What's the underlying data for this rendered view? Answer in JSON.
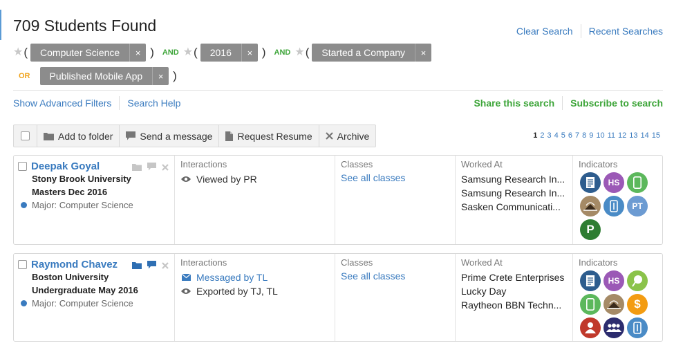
{
  "header": {
    "title": "709 Students Found",
    "clear_search": "Clear Search",
    "recent_searches": "Recent Searches"
  },
  "query": {
    "terms": [
      "Computer Science",
      "2016",
      "Started a Company",
      "Published Mobile App"
    ],
    "op_and": "AND",
    "op_or": "OR",
    "open_paren": "(",
    "close_paren": ")",
    "remove_glyph": "×",
    "star_glyph": "★"
  },
  "filters": {
    "advanced": "Show Advanced Filters",
    "help": "Search Help",
    "share": "Share this search",
    "subscribe": "Subscribe to search"
  },
  "actions": {
    "add_folder": "Add to folder",
    "send_message": "Send a message",
    "request_resume": "Request Resume",
    "archive": "Archive"
  },
  "pagination": {
    "current": "1",
    "pages": [
      "2",
      "3",
      "4",
      "5",
      "6",
      "7",
      "8",
      "9",
      "10",
      "11",
      "12",
      "13",
      "14",
      "15"
    ]
  },
  "columns": {
    "interactions": "Interactions",
    "classes": "Classes",
    "worked_at": "Worked At",
    "indicators": "Indicators"
  },
  "students": [
    {
      "name": "Deepak Goyal",
      "school": "Stony Brook University",
      "degree": "Masters Dec 2016",
      "major": "Major: Computer Science",
      "interactions": [
        "Viewed by PR"
      ],
      "classes_link": "See all classes",
      "worked_at": [
        "Samsung Research In...",
        "Samsung Research In...",
        "Sasken Communicati..."
      ],
      "indicators": [
        {
          "icon": "resume-icon",
          "text": "",
          "color": "#2e5d8e"
        },
        {
          "icon": "high-school-icon",
          "text": "HS",
          "color": "#9b59b6"
        },
        {
          "icon": "mobile-icon",
          "text": "",
          "color": "#5cb85c"
        },
        {
          "icon": "academic-icon",
          "text": "",
          "color": "#a58a66"
        },
        {
          "icon": "work-icon",
          "text": "",
          "color": "#4a8bc6"
        },
        {
          "icon": "part-time-icon",
          "text": "PT",
          "color": "#6c9bd2"
        },
        {
          "icon": "patent-icon",
          "text": "P",
          "color": "#2e7d32"
        }
      ]
    },
    {
      "name": "Raymond Chavez",
      "school": "Boston University",
      "degree": "Undergraduate May 2016",
      "major": "Major: Computer Science",
      "interactions": [
        "Messaged by TL",
        "Exported by TJ, TL"
      ],
      "classes_link": "See all classes",
      "worked_at": [
        "Prime Crete Enterprises",
        "Lucky Day",
        "Raytheon BBN Techn..."
      ],
      "indicators": [
        {
          "icon": "resume-icon",
          "text": "",
          "color": "#2e5d8e"
        },
        {
          "icon": "high-school-icon",
          "text": "HS",
          "color": "#9b59b6"
        },
        {
          "icon": "idea-icon",
          "text": "",
          "color": "#8bc34a"
        },
        {
          "icon": "mobile-icon",
          "text": "",
          "color": "#5cb85c"
        },
        {
          "icon": "academic-icon",
          "text": "",
          "color": "#a58a66"
        },
        {
          "icon": "money-icon",
          "text": "$",
          "color": "#f39c12"
        },
        {
          "icon": "leader-icon",
          "text": "",
          "color": "#c0392b"
        },
        {
          "icon": "group-icon",
          "text": "",
          "color": "#2c2c6e"
        },
        {
          "icon": "work-icon",
          "text": "",
          "color": "#4a8bc6"
        }
      ]
    }
  ]
}
